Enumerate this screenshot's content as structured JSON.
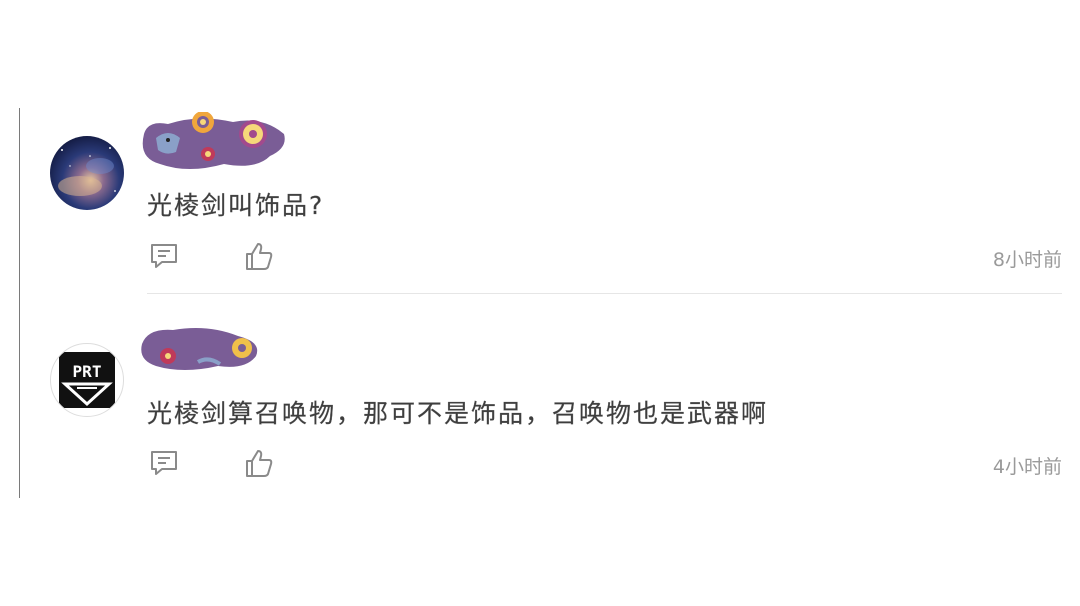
{
  "comments": [
    {
      "text": "光棱剑叫饰品?",
      "time": "8小时前",
      "avatar_icon": "nebula-avatar",
      "sticker_icon": "purple-sticker-name-cover"
    },
    {
      "text": "光棱剑算召唤物，那可不是饰品，召唤物也是武器啊",
      "time": "4小时前",
      "avatar_icon": "prt-logo-avatar",
      "sticker_icon": "purple-sticker-name-cover"
    }
  ],
  "icons": {
    "reply": "comment-icon",
    "like": "thumbs-up-icon"
  },
  "colors": {
    "sticker_purple": "#7a5d96",
    "icon_gray": "#8a8a8a",
    "time_gray": "#9a9a9a",
    "text_dark": "#3d3d3d"
  }
}
